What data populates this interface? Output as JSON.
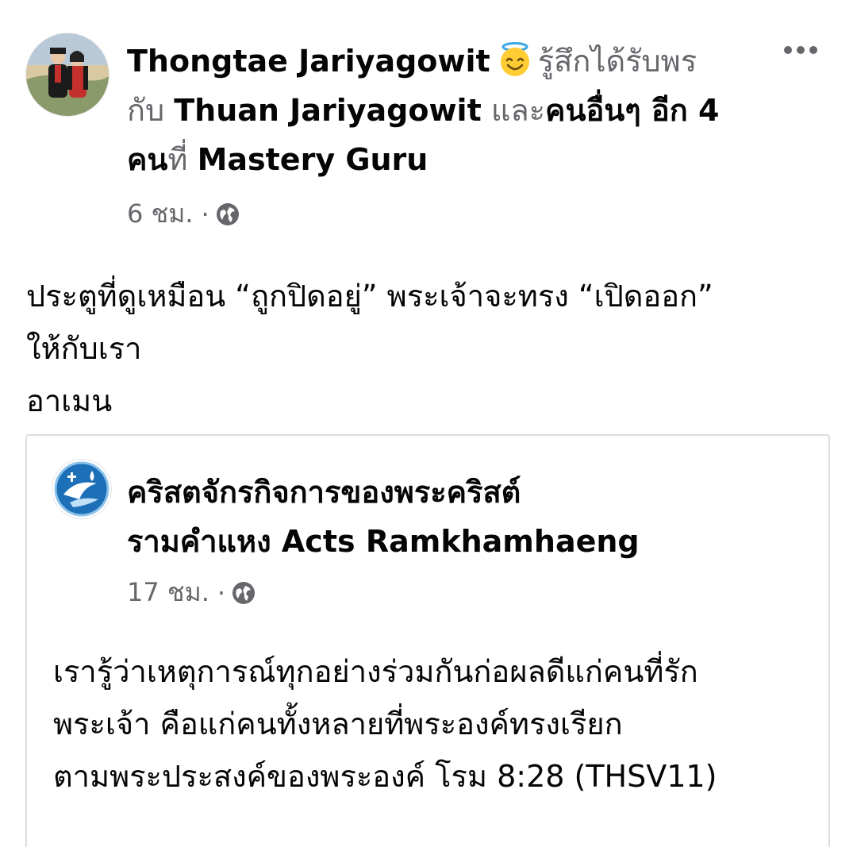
{
  "post": {
    "author": "Thongtae Jariyagowit",
    "feeling_icon": "smiling-face-with-halo-emoji",
    "feeling_text": "รู้สึกได้รับพร",
    "with_word": "กับ",
    "tagged_person": "Thuan Jariyagowit",
    "and_word": "และ",
    "others_text": "คนอื่นๆ อีก 4",
    "others_text_2": "คน",
    "at_word": "ที่",
    "location": "Mastery Guru",
    "timestamp": "6 ชม.",
    "separator": "·",
    "privacy_icon": "globe-icon",
    "more_icon": "more-options-icon",
    "body_lines": [
      "ประตูที่ดูเหมือน “ถูกปิดอยู่” พระเจ้าจะทรง “เปิดออก”",
      "ให้กับเรา",
      "อาเมน"
    ]
  },
  "shared": {
    "page_name_lines": [
      "คริสตจักรกิจการของพระคริสต์",
      "รามคำแหง Acts Ramkhamhaeng"
    ],
    "timestamp": "17 ชม.",
    "separator": "·",
    "privacy_icon": "globe-icon",
    "body_lines": [
      "เรารู้ว่าเหตุการณ์ทุกอย่างร่วมกันก่อผลดีแก่คนที่รัก",
      "พระเจ้า คือแก่คนทั้งหลายที่พระองค์ทรงเรียก",
      "ตามพระประสงค์ของพระองค์  โรม 8:28 (THSV11)"
    ]
  },
  "colors": {
    "text_primary": "#050505",
    "text_secondary": "#65676b",
    "card_border": "#dadde1",
    "logo_blue": "#1d6fb8"
  }
}
